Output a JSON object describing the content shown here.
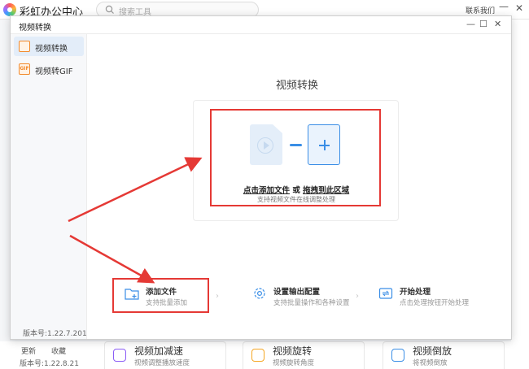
{
  "app": {
    "title": "彩虹办公中心",
    "search_placeholder": "搜索工具",
    "contact": "联系我们",
    "minimize_glyph": "—",
    "close_glyph": "✕",
    "update": "更新",
    "favorite": "收藏",
    "version": "版本号:1.22.8.21"
  },
  "tool_cards": [
    {
      "title": "视频加减速",
      "desc": "视频调整播放速度",
      "icon": "speed-icon",
      "color": "#8b5cf6"
    },
    {
      "title": "视频旋转",
      "desc": "视频旋转角度",
      "icon": "rotate-icon",
      "color": "#f5a623"
    },
    {
      "title": "视频倒放",
      "desc": "将视频倒放",
      "icon": "reverse-icon",
      "color": "#3a8ee6"
    }
  ],
  "dialog": {
    "title": "视频转换",
    "controls": [
      "—",
      "☐",
      "✕"
    ],
    "sidebar": [
      {
        "label": "视频转换",
        "icon": "video-convert-icon",
        "active": true
      },
      {
        "label": "视频转GIF",
        "icon": "gif-icon",
        "icon_text": "GIF",
        "active": false
      }
    ],
    "version": "版本号:1.22.7.201",
    "content_title": "视频转换",
    "drop": {
      "main_click": "点击添加文件",
      "main_or": " 或 ",
      "main_drag": "拖拽到此区域",
      "sub": "支持视频文件在线调整处理"
    },
    "steps": [
      {
        "title": "添加文件",
        "desc": "支持批量添加",
        "icon": "folder-add-icon"
      },
      {
        "title": "设置输出配置",
        "desc": "支持批量操作和各种设置",
        "icon": "settings-gear-icon"
      },
      {
        "title": "开始处理",
        "desc": "点击处理按钮开始处理",
        "icon": "process-icon"
      }
    ],
    "step_arrow": "›"
  },
  "colors": {
    "accent": "#3a8ee6",
    "sidebar_icon": "#f28a2c",
    "annotation_red": "#e53935"
  }
}
